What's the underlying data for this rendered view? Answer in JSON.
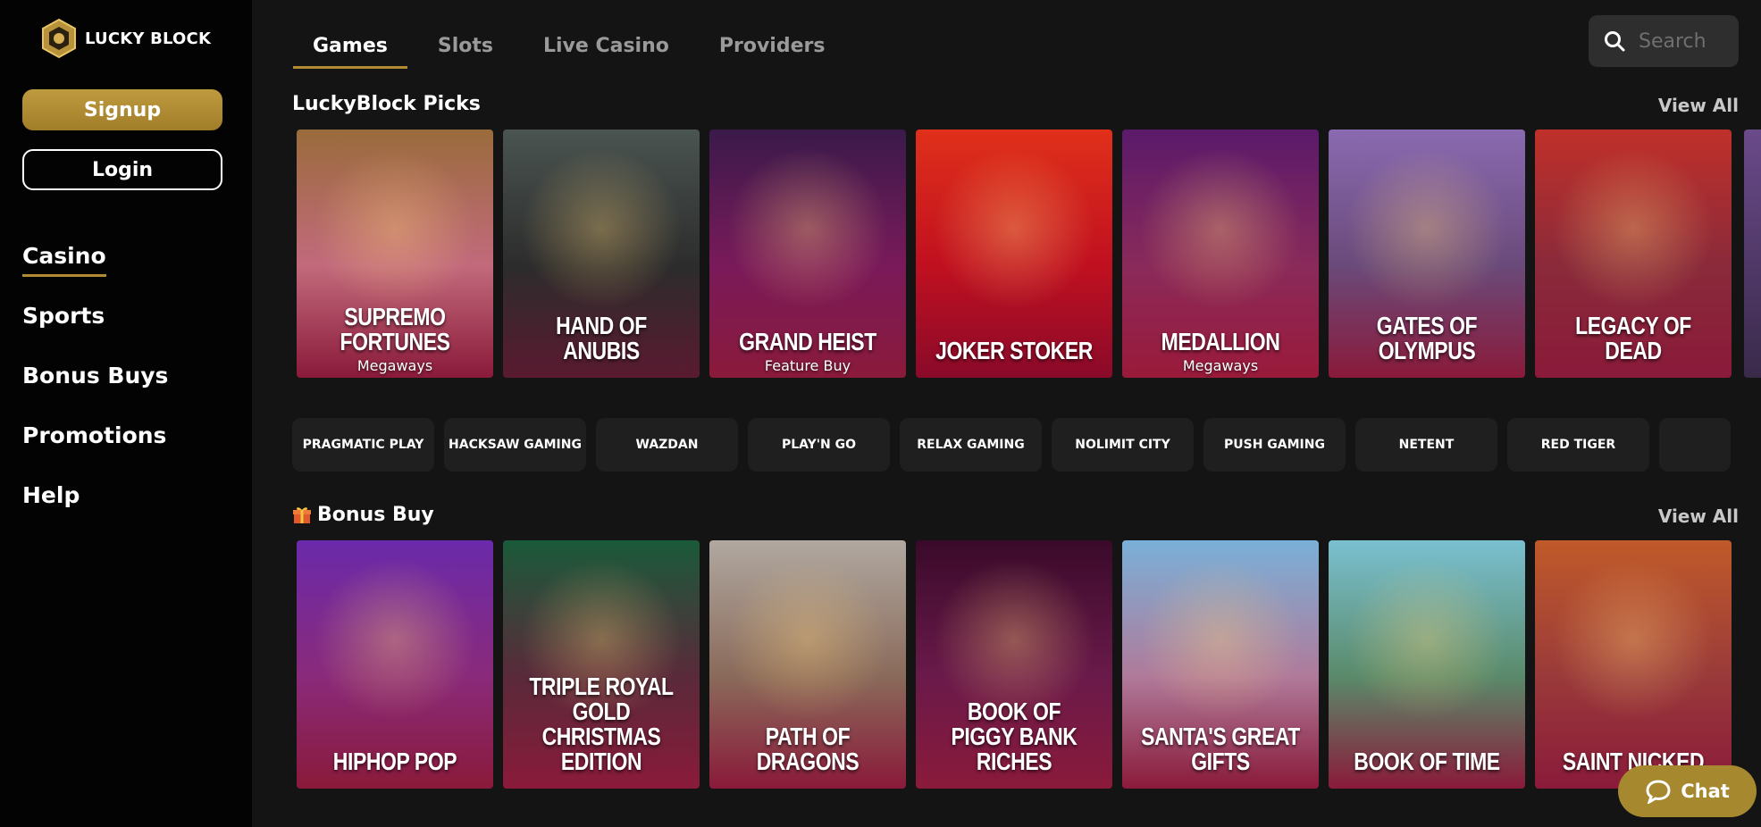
{
  "brand": {
    "name": "LUCKY BLOCK"
  },
  "auth": {
    "signup_label": "Signup",
    "login_label": "Login"
  },
  "nav": [
    {
      "label": "Casino",
      "active": true
    },
    {
      "label": "Sports"
    },
    {
      "label": "Bonus Buys"
    },
    {
      "label": "Promotions"
    },
    {
      "label": "Help"
    }
  ],
  "tabs": [
    {
      "label": "Games",
      "active": true
    },
    {
      "label": "Slots"
    },
    {
      "label": "Live Casino"
    },
    {
      "label": "Providers"
    }
  ],
  "search": {
    "placeholder": "Search",
    "icon": "search-icon"
  },
  "picks": {
    "title": "LuckyBlock Picks",
    "view_all": "View All",
    "games": [
      {
        "title": "SUPREMO FORTUNES",
        "sub": "Megaways",
        "colors": [
          "#9a6b3c",
          "#c26a7c",
          "#8a1a3a"
        ]
      },
      {
        "title": "HAND OF ANUBIS",
        "sub": "",
        "colors": [
          "#4a5450",
          "#2c2c2c",
          "#5a1a30"
        ]
      },
      {
        "title": "GRAND HEIST",
        "sub": "Feature Buy",
        "colors": [
          "#3a1a4a",
          "#7a1a5a",
          "#8a1a3a"
        ]
      },
      {
        "title": "JOKER STOKER",
        "sub": "",
        "colors": [
          "#e0301a",
          "#c01020",
          "#8a0a2a"
        ]
      },
      {
        "title": "MEDALLION",
        "sub": "Megaways",
        "colors": [
          "#5a1a6a",
          "#8a2a5a",
          "#9a1a3a"
        ]
      },
      {
        "title": "GATES OF OLYMPUS",
        "sub": "",
        "colors": [
          "#8a6ab0",
          "#6a4a7a",
          "#8a1a3a"
        ]
      },
      {
        "title": "LEGACY OF DEAD",
        "sub": "",
        "colors": [
          "#c0302a",
          "#8a2a3a",
          "#8a1a3a"
        ]
      }
    ]
  },
  "providers": [
    "PRAGMATIC PLAY",
    "HACKSAW GAMING",
    "WAZDAN",
    "PLAY'N GO",
    "RELAX GAMING",
    "NOLIMIT CITY",
    "PUSH GAMING",
    "NETENT",
    "RED TIGER",
    ""
  ],
  "bonus_buy": {
    "title": "Bonus Buy",
    "view_all": "View All",
    "games": [
      {
        "title": "HIPHOP POP",
        "colors": [
          "#6a2aaa",
          "#8a2a7a",
          "#8a1a3a"
        ]
      },
      {
        "title": "TRIPLE ROYAL GOLD CHRISTMAS EDITION",
        "colors": [
          "#1a5a3a",
          "#5a2a3a",
          "#8a1a3a"
        ]
      },
      {
        "title": "PATH OF DRAGONS",
        "colors": [
          "#b0a8a0",
          "#8a6a5a",
          "#8a1a3a"
        ]
      },
      {
        "title": "BOOK OF PIGGY BANK RICHES",
        "colors": [
          "#3a0a2a",
          "#6a1a4a",
          "#8a1a3a"
        ]
      },
      {
        "title": "SANTA'S GREAT GIFTS",
        "colors": [
          "#7ab0d8",
          "#b07a9a",
          "#8a1a3a"
        ]
      },
      {
        "title": "BOOK OF TIME",
        "colors": [
          "#7ac0d0",
          "#5a8a6a",
          "#8a1a3a"
        ]
      },
      {
        "title": "SAINT NICKED",
        "colors": [
          "#c05a2a",
          "#9a3a3a",
          "#8a1a3a"
        ]
      }
    ]
  },
  "chat": {
    "label": "Chat"
  },
  "colors": {
    "accent": "#b08b34",
    "sidebar": "#030303",
    "main": "#141414"
  }
}
